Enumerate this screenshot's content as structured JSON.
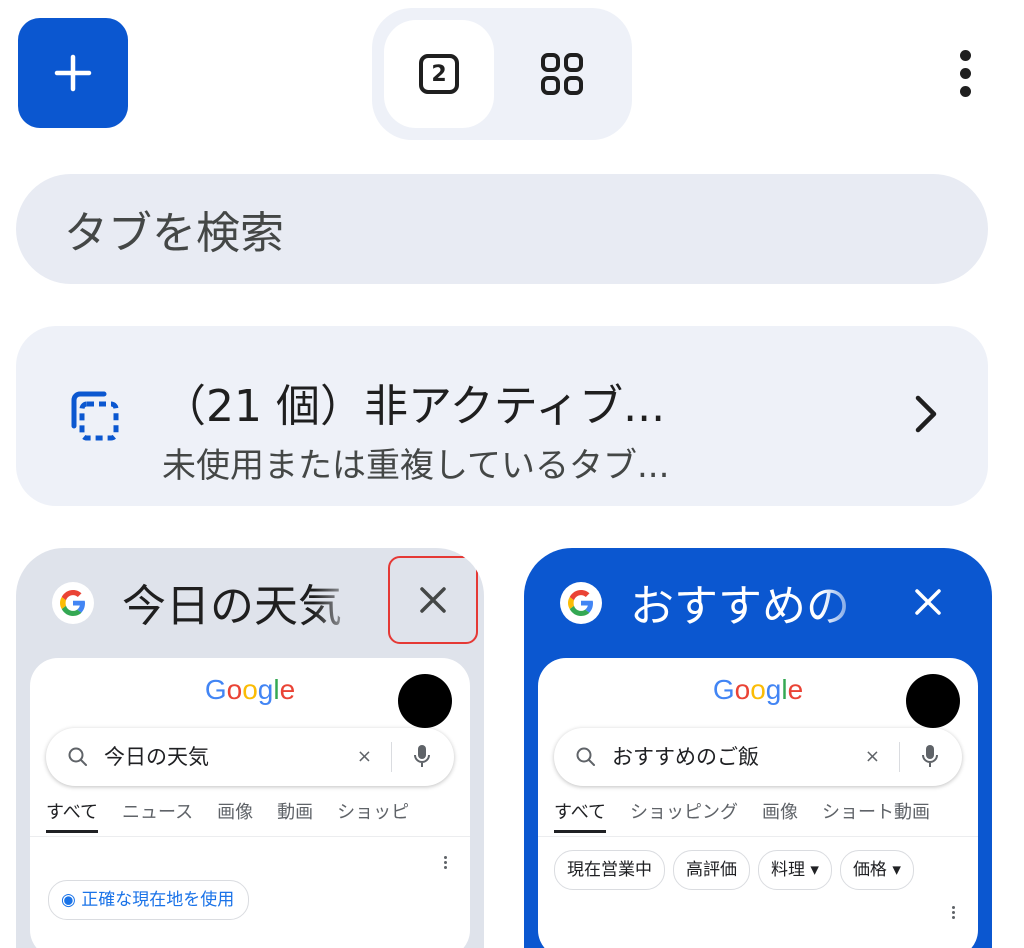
{
  "toolbar": {
    "tab_count": "2"
  },
  "search": {
    "placeholder": "タブを検索"
  },
  "inactive": {
    "title": "（21 個）非アクティブ...",
    "subtitle": "未使用または重複しているタブ..."
  },
  "tabs": [
    {
      "title": "今日の天気",
      "selected": false,
      "preview": {
        "logo": "Google",
        "query": "今日の天気",
        "clear": "×",
        "nav": [
          "すべて",
          "ニュース",
          "画像",
          "動画",
          "ショッピ"
        ],
        "chip": "正確な現在地を使用"
      }
    },
    {
      "title": "おすすめの",
      "selected": true,
      "preview": {
        "logo": "Google",
        "query": "おすすめのご飯",
        "clear": "×",
        "nav": [
          "すべて",
          "ショッピング",
          "画像",
          "ショート動画"
        ],
        "chips": [
          "現在営業中",
          "高評価",
          "料理 ▾",
          "価格 ▾"
        ]
      }
    }
  ],
  "colors": {
    "accent": "#0b57d0",
    "surface": "#eef1f8",
    "highlight": "#e53935"
  }
}
